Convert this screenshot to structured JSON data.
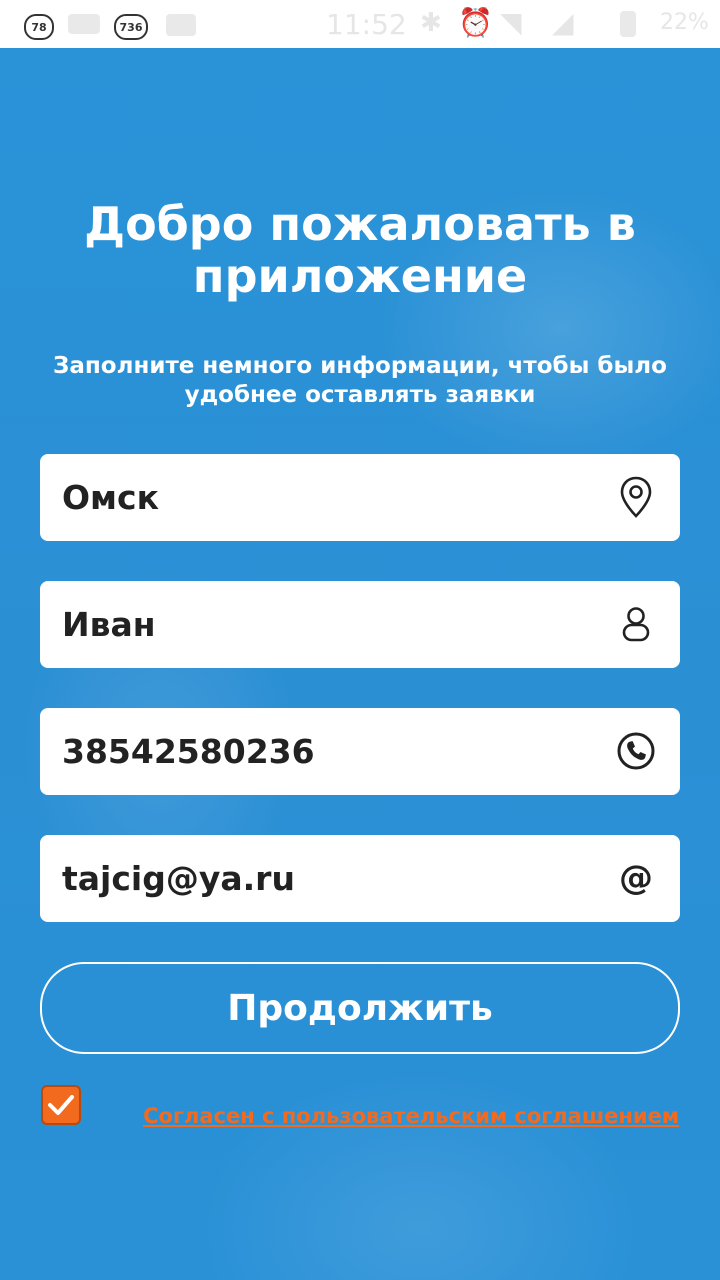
{
  "status_bar": {
    "badge_1": "78",
    "badge_2": "736",
    "time": "11:52",
    "battery": "22%"
  },
  "welcome": {
    "title_line1": "Добро пожаловать в",
    "title_line2": "приложение",
    "subtitle_line1": "Заполните немного информации, чтобы было",
    "subtitle_line2": "удобнее оставлять заявки"
  },
  "form": {
    "city": "Омск",
    "name": "Иван",
    "phone": "38542580236",
    "email": "tajcig@ya.ru",
    "continue_label": "Продолжить",
    "agreement_checked": true,
    "agreement_label": "Согласен с пользовательским соглашением"
  },
  "icons": {
    "city": "location-pin-icon",
    "name": "person-icon",
    "phone": "phone-icon",
    "email": "at-sign-icon",
    "checkbox": "checkmark-icon"
  },
  "colors": {
    "background": "#2891d6",
    "accent": "#f26a1e",
    "field": "#ffffff"
  }
}
